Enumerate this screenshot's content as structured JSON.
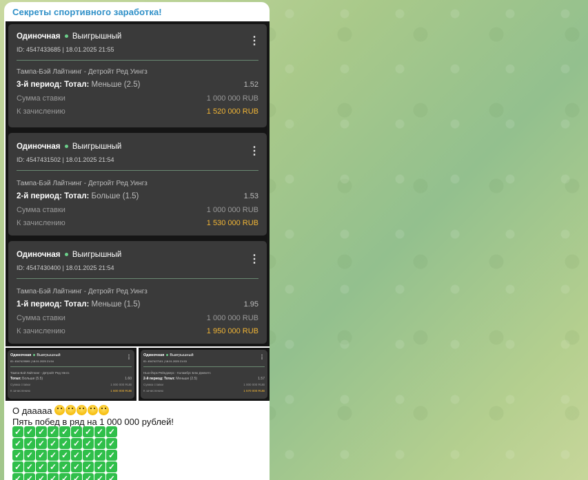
{
  "channel": {
    "name": "Секреты спортивного заработка!"
  },
  "bets": [
    {
      "type": "Одиночная",
      "status": "Выигрышный",
      "id_line": "ID: 4547433685 | 18.01.2025 21:55",
      "match": "Тампа-Бэй Лайтнинг - Детройт Ред Уингз",
      "market": "3-й период: Тотал:",
      "market_value": "Меньше (2.5)",
      "odds": "1.52",
      "stake_label": "Сумма ставки",
      "stake": "1 000 000 RUB",
      "payout_label": "К зачислению",
      "payout": "1 520 000 RUB"
    },
    {
      "type": "Одиночная",
      "status": "Выигрышный",
      "id_line": "ID: 4547431502 | 18.01.2025 21:54",
      "match": "Тампа-Бэй Лайтнинг - Детройт Ред Уингз",
      "market": "2-й период: Тотал:",
      "market_value": "Больше (1.5)",
      "odds": "1.53",
      "stake_label": "Сумма ставки",
      "stake": "1 000 000 RUB",
      "payout_label": "К зачислению",
      "payout": "1 530 000 RUB"
    },
    {
      "type": "Одиночная",
      "status": "Выигрышный",
      "id_line": "ID: 4547430400 | 18.01.2025 21:54",
      "match": "Тампа-Бэй Лайтнинг - Детройт Ред Уингз",
      "market": "1-й период: Тотал:",
      "market_value": "Меньше (1.5)",
      "odds": "1.95",
      "stake_label": "Сумма ставки",
      "stake": "1 000 000 RUB",
      "payout_label": "К зачислению",
      "payout": "1 950 000 RUB"
    },
    {
      "type": "Одиночная",
      "status": "Выигрышный",
      "id_line": "ID: 4547429595 | 18.01.2025 21:54",
      "match": "Тампа-Бэй Лайтнинг - Детройт Ред Уингз",
      "market": "Тотал:",
      "market_value": "Больше (5.5)",
      "odds": "1.60",
      "stake_label": "Сумма ставки",
      "stake": "1 000 000 RUB",
      "payout_label": "К зачислению",
      "payout": "1 600 000 RUB"
    },
    {
      "type": "Одиночная",
      "status": "Выигрышный",
      "id_line": "ID: 4547427101 | 18.01.2025 21:53",
      "match": "Нью-Йорк Рейнджерс - Коламбус Блю Джекетс",
      "market": "2-й период: Тотал:",
      "market_value": "Меньше (2.5)",
      "odds": "1.57",
      "stake_label": "Сумма ставки",
      "stake": "1 000 000 RUB",
      "payout_label": "К зачислению",
      "payout": "1 570 000 RUB"
    }
  ],
  "message": {
    "line1": "О дааааа",
    "line2": "Пять побед в ряд на 1 000 000 рублей!",
    "check_symbol": "✓"
  },
  "icons": {
    "menu": "more-vertical-icon",
    "emoji": "hugging-face-emoji",
    "check": "check-mark-button-emoji"
  },
  "colors": {
    "channel_name": "#2e8fc7",
    "card_bg": "#3a3a3a",
    "status_dot": "#6bcf8a",
    "payout": "#f2b636",
    "check": "#2fbf4a"
  }
}
